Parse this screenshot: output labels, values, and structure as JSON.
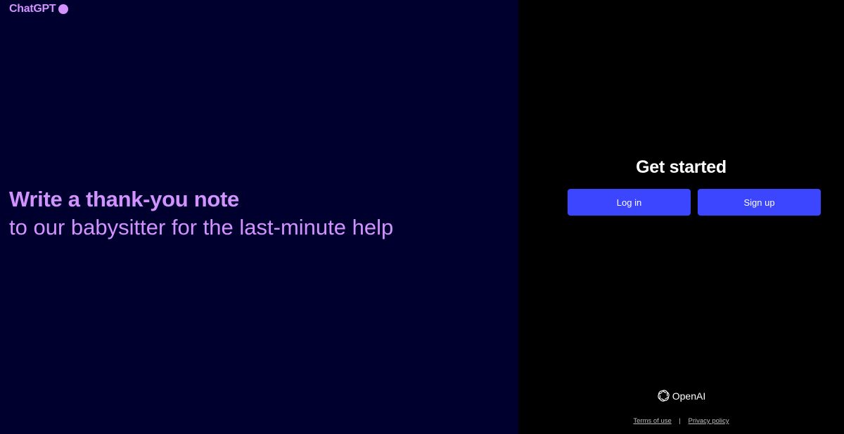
{
  "brand": {
    "name": "ChatGPT",
    "dot_color": "#d292ff"
  },
  "hero": {
    "title": "Write a thank-you note",
    "body": "to our babysitter for the last-minute help"
  },
  "auth": {
    "heading": "Get started",
    "login_label": "Log in",
    "signup_label": "Sign up",
    "button_color": "#3c46ff"
  },
  "footer": {
    "logo_text": "OpenAI",
    "logo_icon": "openai-logo-icon",
    "terms_label": "Terms of use",
    "separator": "|",
    "privacy_label": "Privacy policy"
  },
  "colors": {
    "left_bg": "#00002e",
    "right_bg": "#000000",
    "accent": "#d292ff"
  }
}
